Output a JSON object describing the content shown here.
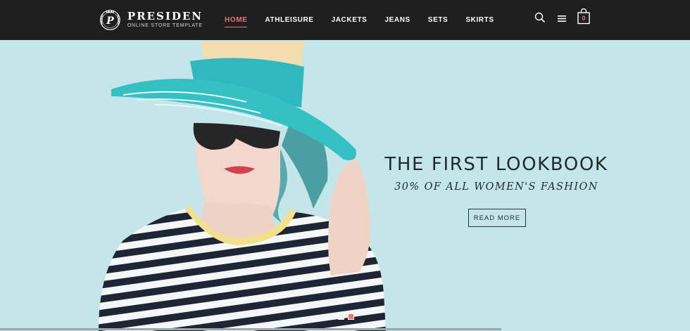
{
  "brand": {
    "name": "PRESIDEN",
    "tagline": "ONLINE STORE TEMPLATE",
    "mark_letter": "P"
  },
  "nav": {
    "items": [
      {
        "label": "HOME",
        "active": true
      },
      {
        "label": "ATHLEISURE",
        "active": false
      },
      {
        "label": "JACKETS",
        "active": false
      },
      {
        "label": "JEANS",
        "active": false
      },
      {
        "label": "SETS",
        "active": false
      },
      {
        "label": "SKIRTS",
        "active": false
      }
    ]
  },
  "header_icons": {
    "search": "search-icon",
    "menu": "menu-icon",
    "cart": "shopping-bag-icon",
    "cart_count": "0"
  },
  "hero": {
    "title": "THE FIRST LOOKBOOK",
    "subtitle": "30% OF ALL WOMEN'S FASHION",
    "button_label": "READ MORE",
    "slides_total": 2,
    "slide_active": 2
  },
  "colors": {
    "header_bg": "#1f1f1f",
    "accent": "#f0707a",
    "hero_bg": "#c4e6ea",
    "text_dark": "#1f2a2f"
  }
}
